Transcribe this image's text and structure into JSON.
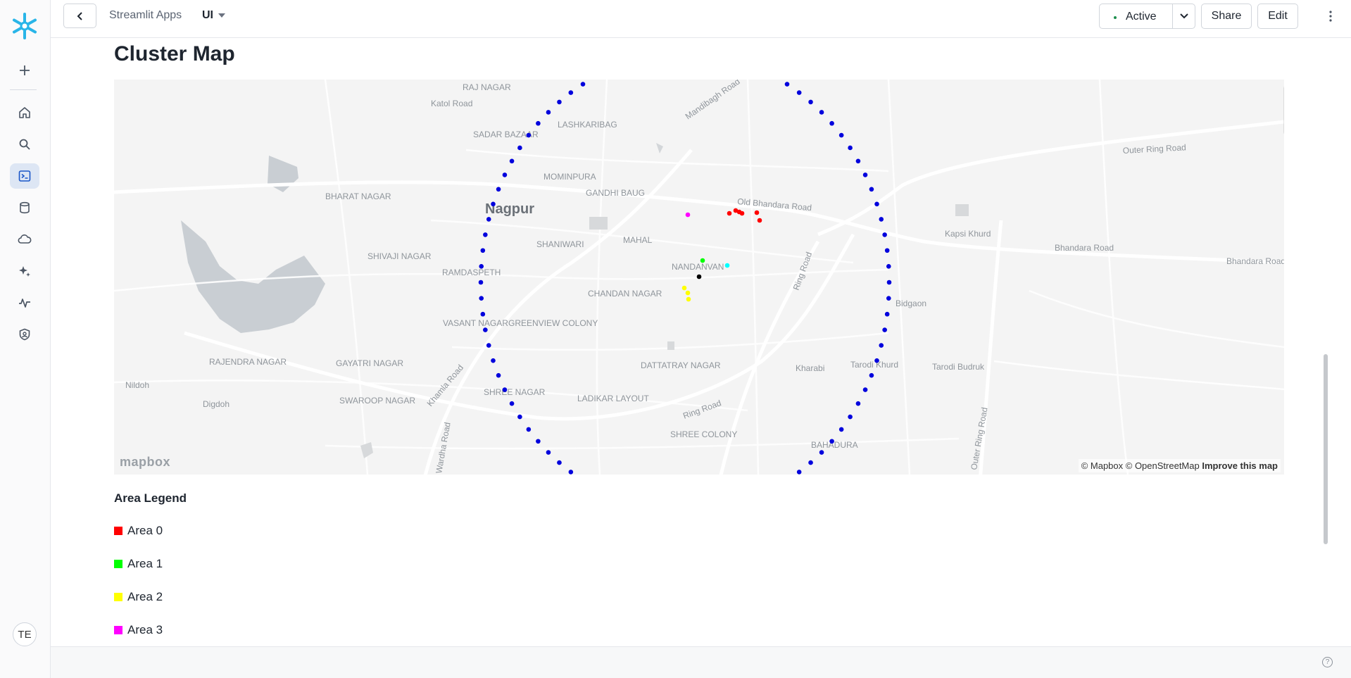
{
  "topbar": {
    "breadcrumb_app": "Streamlit Apps",
    "breadcrumb_page": "UI",
    "status_label": "Active",
    "share_label": "Share",
    "edit_label": "Edit"
  },
  "sidebar": {
    "items": [
      "add",
      "home",
      "search",
      "projects",
      "data",
      "cloud",
      "ai",
      "monitoring",
      "admin"
    ],
    "active_item": "projects",
    "avatar_initials": "TE"
  },
  "main": {
    "title": "Cluster Map",
    "map": {
      "zoom_in": "+",
      "zoom_out": "−",
      "attribution": "© Mapbox © OpenStreetMap",
      "improve_link": "Improve this map",
      "logo_text": "mapbox",
      "city_label": "Nagpur",
      "place_labels": [
        "RAJ NAGAR",
        "Katol Road",
        "LASHKARIBAG",
        "SADAR BAZAAR",
        "MOMINPURA",
        "GANDHI BAUG",
        "BHARAT NAGAR",
        "Old Bhandara Road",
        "Kapsi Khurd",
        "Outer Ring Road",
        "Bhandara Road",
        "Bhandara Road",
        "SHIVAJI NAGAR",
        "RAMDASPETH",
        "SHANIWARI",
        "MAHAL",
        "NANDANVAN",
        "Ring Road",
        "Bidgaon",
        "CHANDAN NAGAR",
        "VASANT NAGAR",
        "GREENVIEW COLONY",
        "RAJENDRA NAGAR",
        "GAYATRI NAGAR",
        "Kharabi",
        "Tarodi Khurd",
        "Tarodi Budruk",
        "DATTATRAY NAGAR",
        "Nildoh",
        "Digdoh",
        "SWAROOP NAGAR",
        "Khamla Road",
        "SHREE NAGAR",
        "LADIKAR LAYOUT",
        "Ring Road",
        "SHREE COLONY",
        "BAHADURA",
        "Outer Ring Road",
        "Mandibagh Road",
        "Wardha Road"
      ]
    },
    "legend": {
      "title": "Area Legend",
      "items": [
        {
          "label": "Area 0",
          "color": "#ff0000"
        },
        {
          "label": "Area 1",
          "color": "#00ff00"
        },
        {
          "label": "Area 2",
          "color": "#ffff00"
        },
        {
          "label": "Area 3",
          "color": "#ff00ff"
        }
      ]
    }
  },
  "colors": {
    "ring_points": "#0000dd",
    "area0": "#ff0000",
    "area1": "#00ff00",
    "area2": "#ffff00",
    "area3": "#ff00ff",
    "area4": "#00ffff",
    "area5": "#000000",
    "accent": "#29b5e8"
  }
}
